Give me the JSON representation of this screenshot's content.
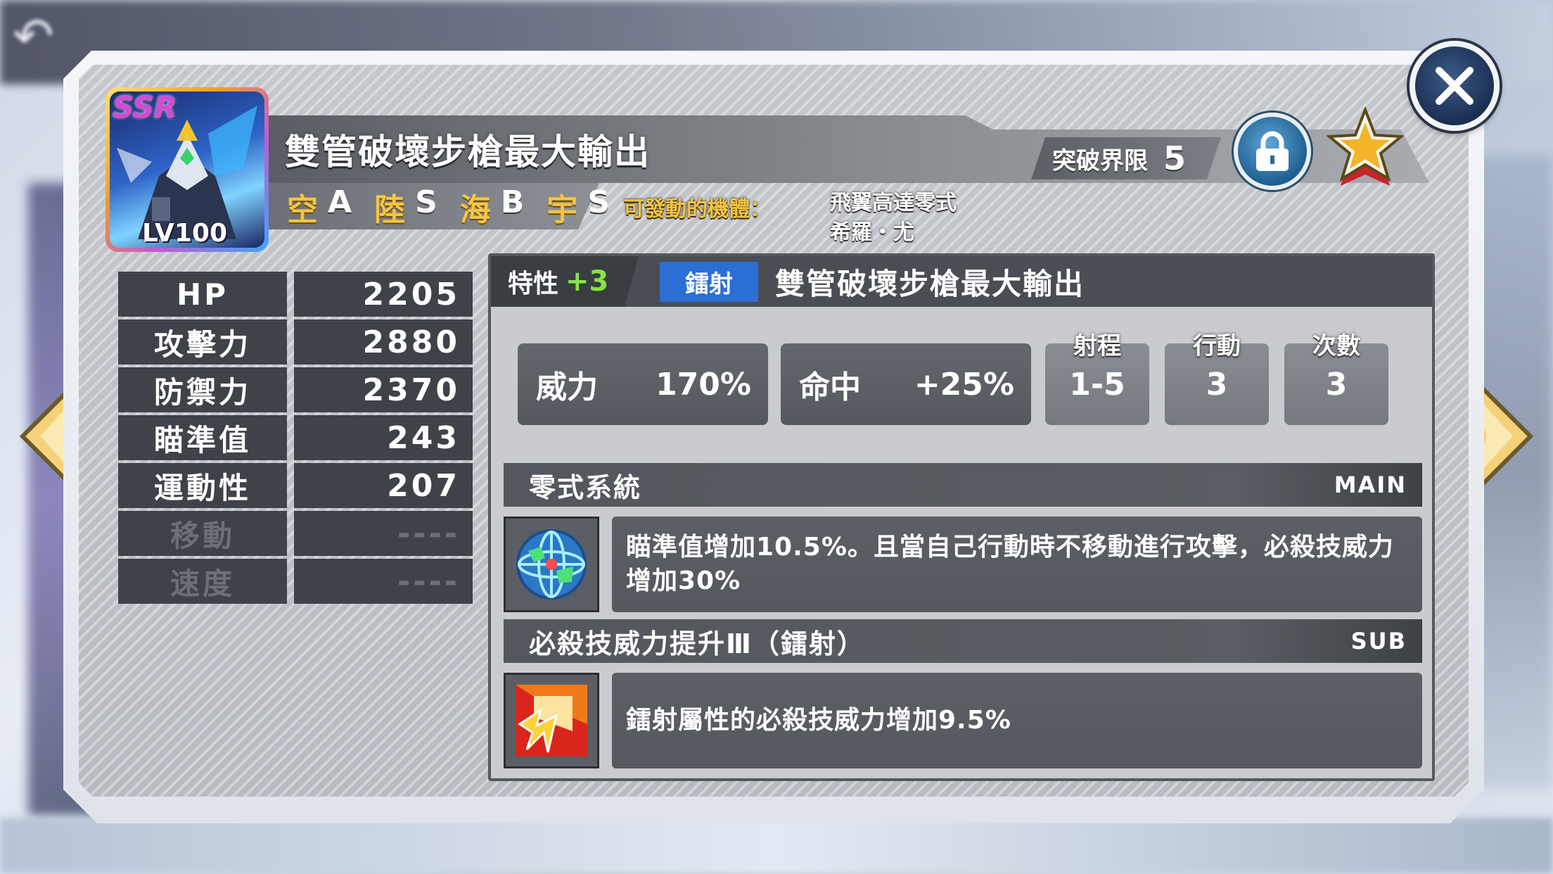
{
  "header": {
    "title": "雙管破壞步槍最大輸出",
    "rarity": "SSR",
    "level": "LV100",
    "terrain": [
      {
        "name": "空",
        "rank": "A"
      },
      {
        "name": "陸",
        "rank": "S"
      },
      {
        "name": "海",
        "rank": "B"
      },
      {
        "name": "宇",
        "rank": "S"
      }
    ],
    "pilot_label": "可發動的機體：",
    "pilot_names": [
      "飛翼高達零式",
      "希羅・尤"
    ],
    "limit_break_label": "突破界限",
    "limit_break_value": "5"
  },
  "stats": [
    {
      "label": "HP",
      "value": "2205"
    },
    {
      "label": "攻擊力",
      "value": "2880"
    },
    {
      "label": "防禦力",
      "value": "2370"
    },
    {
      "label": "瞄準值",
      "value": "243"
    },
    {
      "label": "運動性",
      "value": "207"
    },
    {
      "label": "移動",
      "value": "----"
    },
    {
      "label": "速度",
      "value": "----"
    }
  ],
  "attack": {
    "trait_label": "特性",
    "trait_bonus": "+3",
    "type_badge": "鐳射",
    "name": "雙管破壞步槍最大輸出",
    "power_label": "威力",
    "power_value": "170%",
    "hit_label": "命中",
    "hit_value": "+25%",
    "range_label": "射程",
    "range_value": "1-5",
    "action_label": "行動",
    "action_value": "3",
    "count_label": "次數",
    "count_value": "3"
  },
  "skills": {
    "main": {
      "name": "零式系統",
      "tag": "MAIN",
      "icon": "globe-icon",
      "description": "瞄準值增加10.5%。且當自己行動時不移動進行攻擊，必殺技威力增加30%"
    },
    "sub": {
      "name": "必殺技威力提升Ⅲ（鐳射）",
      "tag": "SUB",
      "icon": "burst-icon",
      "description": "鐳射屬性的必殺技威力增加9.5%"
    }
  },
  "colors": {
    "terrain_name": "#f4c543",
    "trait_bonus": "#8ae24a",
    "beam_badge": "#2b6ed6"
  }
}
